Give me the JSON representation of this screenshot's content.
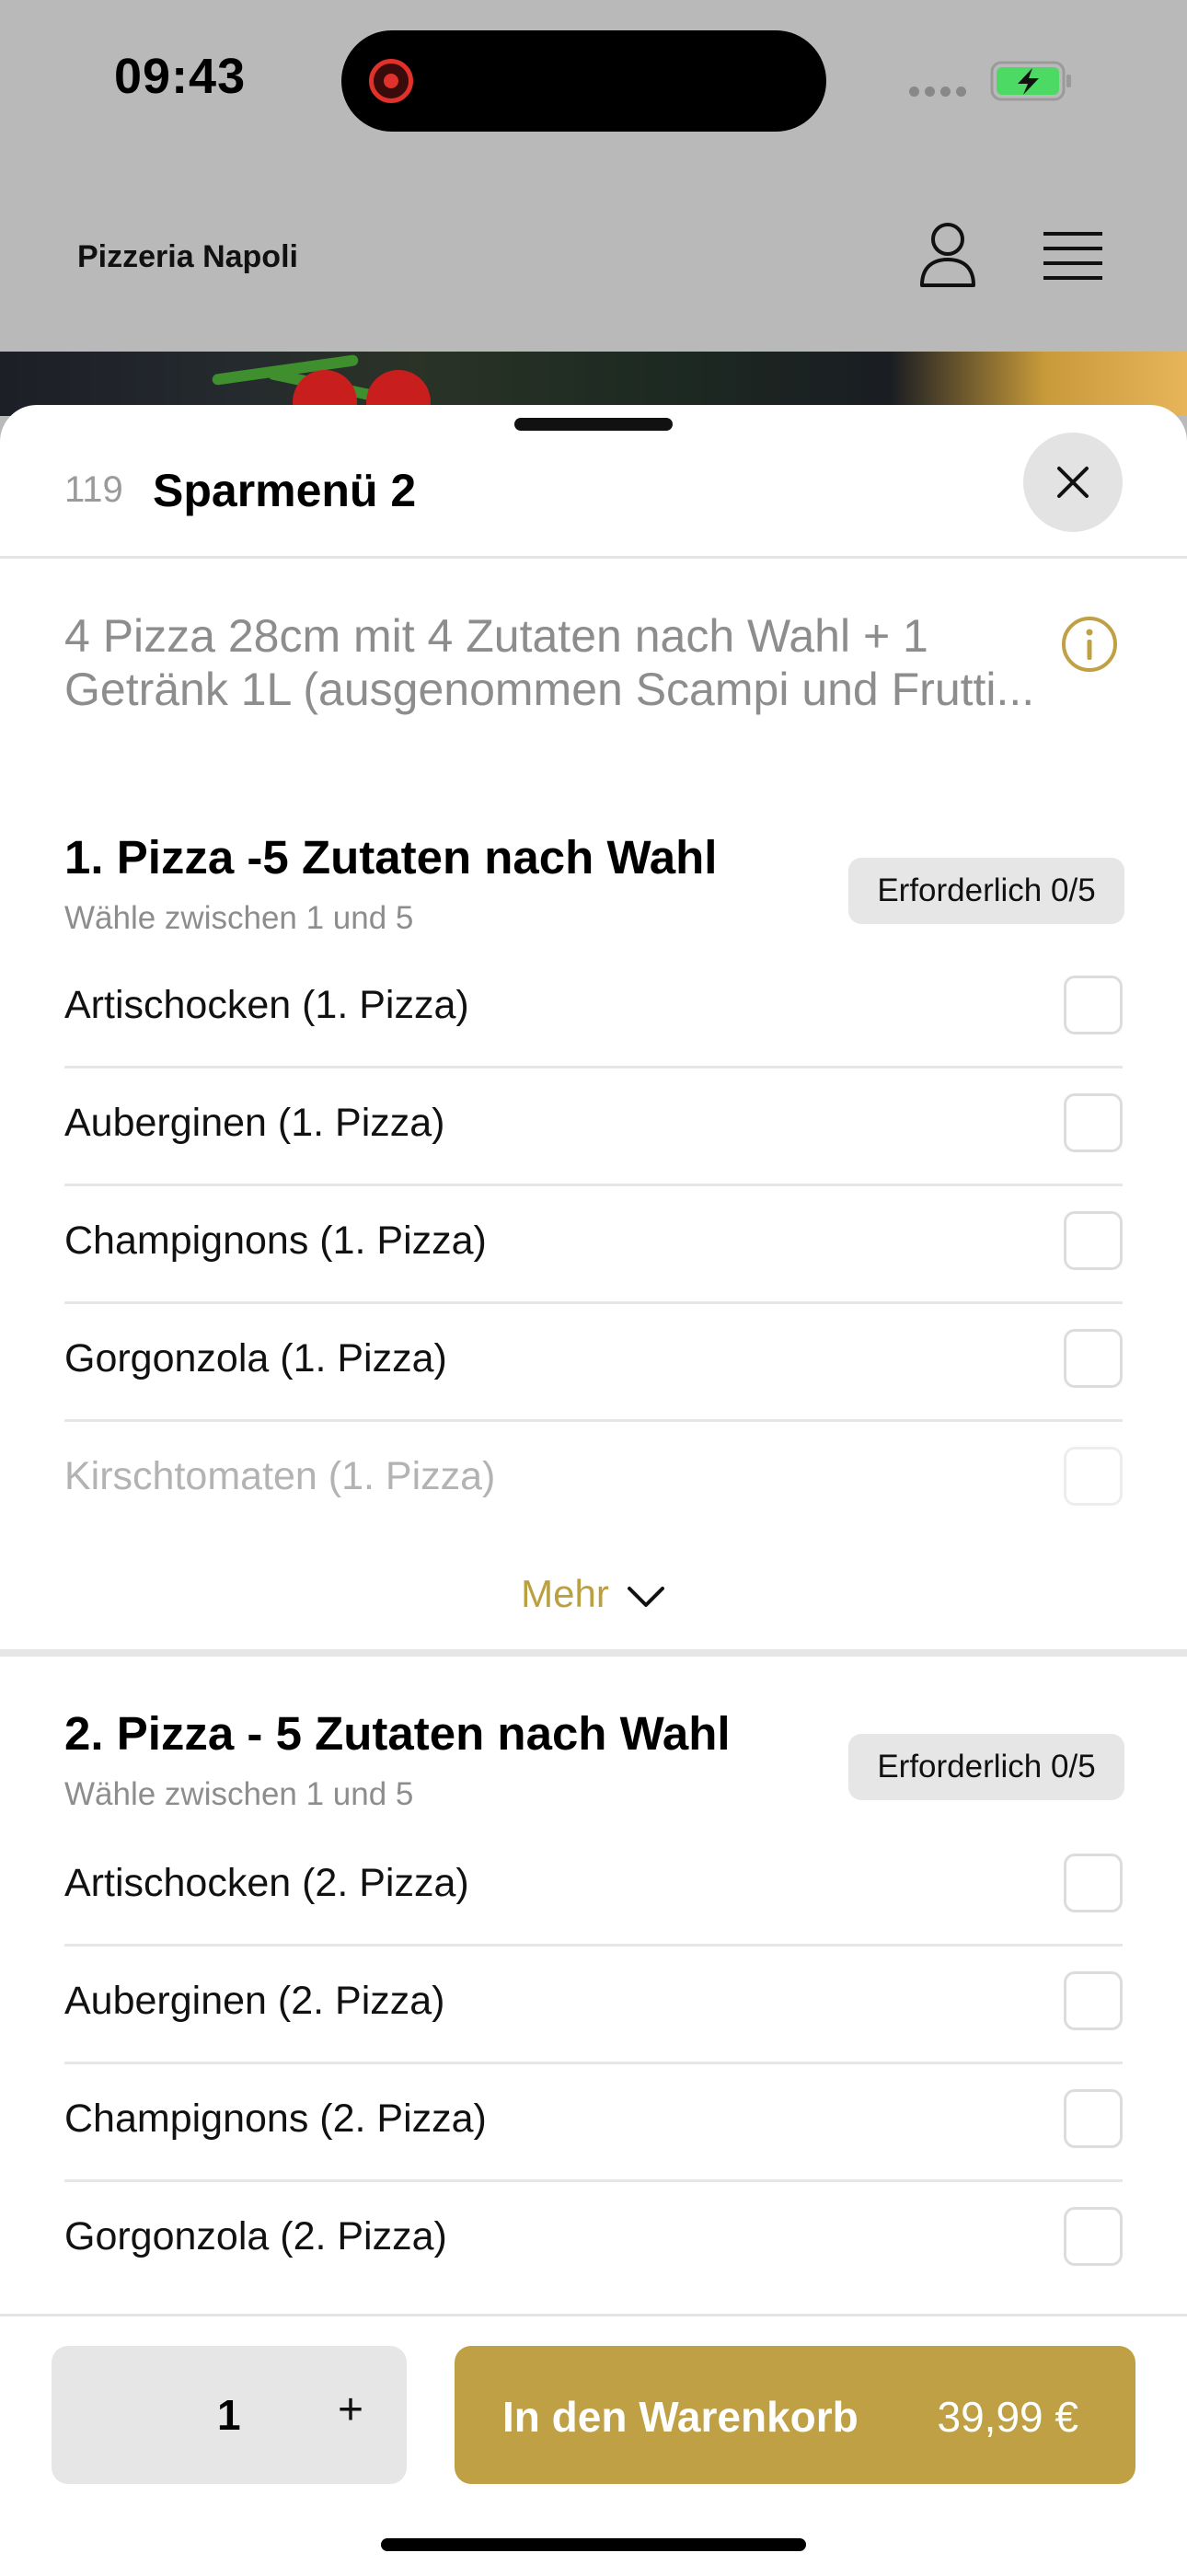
{
  "status_bar": {
    "time": "09:43",
    "icons": [
      "screen-recording-icon",
      "signal-icon",
      "battery-charging-icon"
    ],
    "battery_color": "#4cd964"
  },
  "header": {
    "brand": "Pizzeria Napoli",
    "icons": [
      "user-icon",
      "menu-icon"
    ]
  },
  "sheet": {
    "item_number": "119",
    "title": "Sparmenü 2",
    "description": "4 Pizza 28cm mit 4 Zutaten nach Wahl + 1 Getränk 1L (ausgenommen Scampi und Frutti...",
    "groups": [
      {
        "title": "1. Pizza -5  Zutaten nach Wahl",
        "subtitle": "Wähle zwischen 1 und 5",
        "badge": "Erforderlich 0/5",
        "options": [
          "Artischocken (1. Pizza)",
          "Auberginen (1. Pizza)",
          "Champignons (1. Pizza)",
          "Gorgonzola (1. Pizza)",
          "Kirschtomaten (1. Pizza)"
        ],
        "more_label": "Mehr"
      },
      {
        "title": "2. Pizza - 5 Zutaten nach Wahl",
        "subtitle": "Wähle zwischen 1 und 5",
        "badge": "Erforderlich 0/5",
        "options": [
          "Artischocken (2. Pizza)",
          "Auberginen (2. Pizza)",
          "Champignons (2. Pizza)",
          "Gorgonzola (2. Pizza)"
        ]
      }
    ]
  },
  "footer": {
    "quantity": "1",
    "plus": "+",
    "cart_label": "In den Warenkorb",
    "price": "39,99 €"
  },
  "colors": {
    "accent": "#bfa044",
    "backdrop": "#b9b9b9",
    "badge_bg": "#e6e6e6"
  }
}
